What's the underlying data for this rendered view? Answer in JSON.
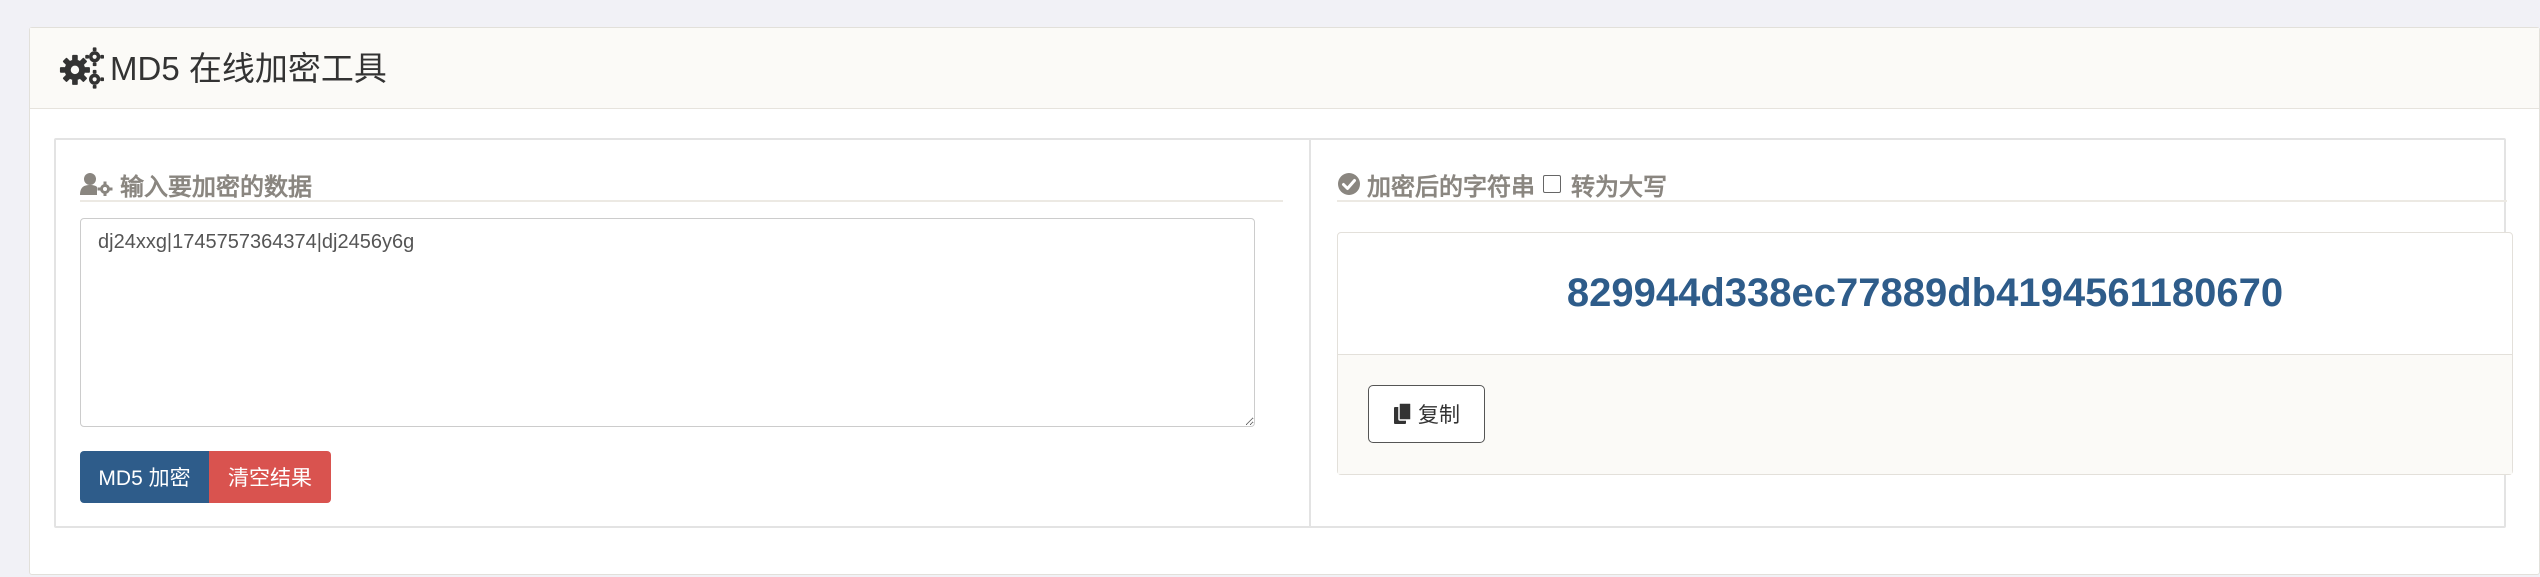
{
  "header": {
    "title": "MD5 在线加密工具",
    "icon": "gears-icon"
  },
  "input_section": {
    "title": "输入要加密的数据",
    "icon": "user-cog-icon",
    "value": "dj24xxg|1745757364374|dj2456y6g"
  },
  "buttons": {
    "encrypt_label": "MD5 加密",
    "clear_label": "清空结果"
  },
  "result_section": {
    "title": "加密后的字符串",
    "icon": "check-circle-icon",
    "uppercase_label": "转为大写",
    "uppercase_checked": false,
    "hash": "829944d338ec77889db4194561180670",
    "copy_label": "复制",
    "copy_icon": "copy-icon"
  },
  "colors": {
    "primary": "#2e5c8a",
    "danger": "#d9534f",
    "muted_heading": "#8a8680",
    "background": "#f1f1f6"
  }
}
